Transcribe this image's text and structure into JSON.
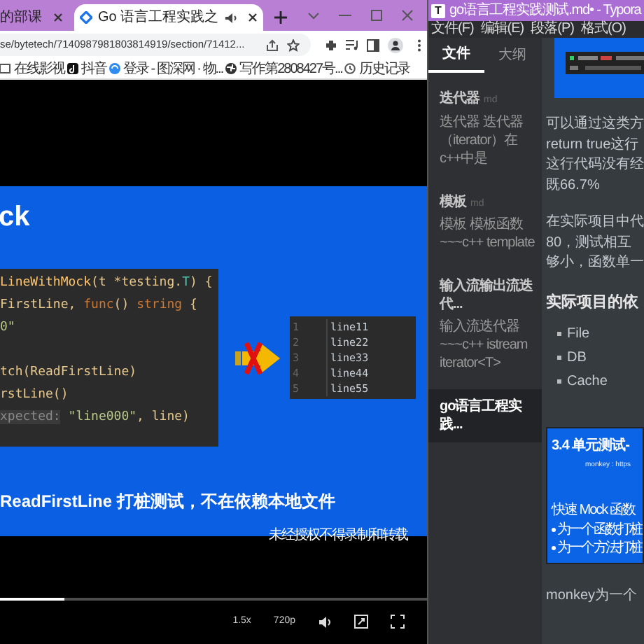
{
  "browser": {
    "tabs": [
      {
        "title": "的部课",
        "selected": false,
        "audio": false
      },
      {
        "title": "Go 语言工程实践之",
        "selected": true,
        "audio": true
      }
    ],
    "address": "se/bytetech/7140987981803814919/section/71412...",
    "bookmarks": [
      {
        "label": "在线影视"
      },
      {
        "label": "抖音"
      },
      {
        "label": "登录 - 图深网 · 物..."
      },
      {
        "label": "写作第2808427号..."
      },
      {
        "label": "历史记录"
      }
    ],
    "video": {
      "slide": {
        "title": "ck",
        "code_lines": [
          {
            "kind": "code",
            "tokens": [
              {
                "kind": "fn",
                "text": "LineWithMock"
              },
              {
                "kind": "plain",
                "text": "(t *testing."
              },
              {
                "kind": "type",
                "text": "T"
              },
              {
                "kind": "plain",
                "text": ") {"
              }
            ]
          },
          {
            "kind": "code",
            "tokens": [
              {
                "kind": "plain",
                "text": "FirstLine, "
              },
              {
                "kind": "kw",
                "text": "func"
              },
              {
                "kind": "plain",
                "text": "() "
              },
              {
                "kind": "kw",
                "text": "string"
              },
              {
                "kind": "plain",
                "text": " {"
              }
            ]
          },
          {
            "kind": "code",
            "tokens": [
              {
                "kind": "str",
                "text": "0\""
              }
            ]
          },
          {
            "kind": "blank"
          },
          {
            "kind": "code",
            "tokens": [
              {
                "kind": "plain",
                "text": "tch(ReadFirstLine)"
              }
            ]
          },
          {
            "kind": "code",
            "tokens": [
              {
                "kind": "plain",
                "text": "rstLine()"
              }
            ]
          },
          {
            "kind": "code",
            "tokens": [
              {
                "kind": "hint",
                "text": "xpected:"
              },
              {
                "kind": "str",
                "text": " \"line000\""
              },
              {
                "kind": "plain",
                "text": ", line)"
              }
            ]
          }
        ],
        "file_lines": [
          {
            "number": "1",
            "text": "line11"
          },
          {
            "number": "2",
            "text": "line22"
          },
          {
            "number": "3",
            "text": "line33"
          },
          {
            "number": "4",
            "text": "line44"
          },
          {
            "number": "5",
            "text": "line55"
          }
        ],
        "caption": "ReadFirstLine 打桩测试，不在依赖本地文件",
        "notice": "未经授权不得录制和转载"
      },
      "progress": {
        "level": 0.15
      },
      "speed": "1.5x",
      "quality": "720p"
    }
  },
  "typora": {
    "logo": "T",
    "title": "go语言工程实践测试.md• - Typora",
    "menu": [
      "文件(F)",
      "编辑(E)",
      "段落(P)",
      "格式(O)"
    ],
    "sidebar": {
      "tabs": [
        {
          "label": "文件",
          "selected": true
        },
        {
          "label": "大纲",
          "selected": false
        }
      ],
      "files": [
        {
          "name": "迭代器",
          "ext": "md",
          "preview": "迭代器 迭代器（iterator）在c++中是",
          "selected": false
        },
        {
          "name": "模板",
          "ext": "md",
          "preview": "模板 模板函数 ~~~c++ template",
          "selected": false
        },
        {
          "name": "输入流输出流迭代...",
          "preview": "输入流迭代器 ~~~c++ istream iterator<T>",
          "selected": false
        },
        {
          "name": "go语言工程实践...",
          "selected": true
        }
      ]
    },
    "content": {
      "paragraphs": [
        {
          "lines": [
            "可以通过这类方",
            "return true这行",
            "这行代码没有经",
            "既66.7%"
          ]
        },
        {
          "lines": [
            "在实际项目中代",
            "80，测试相互",
            "够小，函数单一"
          ]
        }
      ],
      "heading": "实际项目的依",
      "list": [
        "File",
        "DB",
        "Cache"
      ],
      "slide": {
        "title": "3.4 单元测试-",
        "link": "monkey : https",
        "subtitle": "快速 Mock 函数",
        "bullets": [
          "为一个函数打桩",
          "为一个方法打桩"
        ]
      },
      "after": "monkey为一个"
    }
  }
}
